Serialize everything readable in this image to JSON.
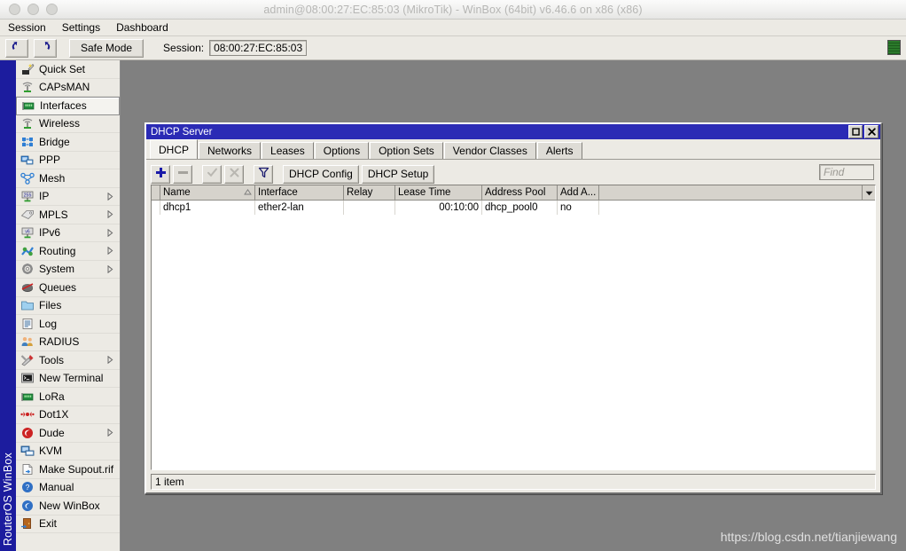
{
  "window": {
    "title": "admin@08:00:27:EC:85:03 (MikroTik) - WinBox (64bit) v6.46.6 on x86 (x86)"
  },
  "menubar": {
    "items": [
      {
        "label": "Session"
      },
      {
        "label": "Settings"
      },
      {
        "label": "Dashboard"
      }
    ]
  },
  "toolbar": {
    "undo_icon": "undo-arrow-icon",
    "redo_icon": "redo-arrow-icon",
    "safe_mode_label": "Safe Mode",
    "session_label": "Session:",
    "session_value": "08:00:27:EC:85:03",
    "status_indicator": "traffic-indicator",
    "accent_color": "#2b2bb5"
  },
  "brand": {
    "vertical_text": "RouterOS WinBox",
    "strip_color": "#1c1c9e"
  },
  "sidebar": {
    "items": [
      {
        "label": "Quick Set",
        "icon": "quick-set-icon",
        "submenu": false
      },
      {
        "label": "CAPsMAN",
        "icon": "capsman-icon",
        "submenu": false
      },
      {
        "label": "Interfaces",
        "icon": "interfaces-icon",
        "submenu": false,
        "selected": true
      },
      {
        "label": "Wireless",
        "icon": "wireless-icon",
        "submenu": false
      },
      {
        "label": "Bridge",
        "icon": "bridge-icon",
        "submenu": false
      },
      {
        "label": "PPP",
        "icon": "ppp-icon",
        "submenu": false
      },
      {
        "label": "Mesh",
        "icon": "mesh-icon",
        "submenu": false
      },
      {
        "label": "IP",
        "icon": "ip-icon",
        "submenu": true
      },
      {
        "label": "MPLS",
        "icon": "mpls-icon",
        "submenu": true
      },
      {
        "label": "IPv6",
        "icon": "ipv6-icon",
        "submenu": true
      },
      {
        "label": "Routing",
        "icon": "routing-icon",
        "submenu": true
      },
      {
        "label": "System",
        "icon": "system-gear-icon",
        "submenu": true
      },
      {
        "label": "Queues",
        "icon": "queues-icon",
        "submenu": false
      },
      {
        "label": "Files",
        "icon": "files-folder-icon",
        "submenu": false
      },
      {
        "label": "Log",
        "icon": "log-icon",
        "submenu": false
      },
      {
        "label": "RADIUS",
        "icon": "radius-users-icon",
        "submenu": false
      },
      {
        "label": "Tools",
        "icon": "tools-icon",
        "submenu": true
      },
      {
        "label": "New Terminal",
        "icon": "terminal-icon",
        "submenu": false
      },
      {
        "label": "LoRa",
        "icon": "lora-icon",
        "submenu": false
      },
      {
        "label": "Dot1X",
        "icon": "dot1x-icon",
        "submenu": false
      },
      {
        "label": "Dude",
        "icon": "dude-icon",
        "submenu": true
      },
      {
        "label": "KVM",
        "icon": "kvm-icon",
        "submenu": false
      },
      {
        "label": "Make Supout.rif",
        "icon": "supout-file-icon",
        "submenu": false
      },
      {
        "label": "Manual",
        "icon": "manual-help-icon",
        "submenu": false
      },
      {
        "label": "New WinBox",
        "icon": "new-winbox-icon",
        "submenu": false
      },
      {
        "label": "Exit",
        "icon": "exit-door-icon",
        "submenu": false
      }
    ]
  },
  "dhcp_window": {
    "title": "DHCP Server",
    "restore_button": "restore-icon",
    "close_button": "close-icon",
    "tabs": [
      {
        "label": "DHCP",
        "active": true
      },
      {
        "label": "Networks",
        "active": false
      },
      {
        "label": "Leases",
        "active": false
      },
      {
        "label": "Options",
        "active": false
      },
      {
        "label": "Option Sets",
        "active": false
      },
      {
        "label": "Vendor Classes",
        "active": false
      },
      {
        "label": "Alerts",
        "active": false
      }
    ],
    "toolbar": {
      "add_label": "+",
      "remove_label": "–",
      "enable_label": "✓",
      "disable_label": "✗",
      "filter_label": "filter",
      "dhcp_config_label": "DHCP Config",
      "dhcp_setup_label": "DHCP Setup",
      "find_placeholder": "Find"
    },
    "table": {
      "columns": [
        {
          "label": "Name",
          "width": 107,
          "sorted": true
        },
        {
          "label": "Interface",
          "width": 100,
          "sorted": false
        },
        {
          "label": "Relay",
          "width": 58,
          "sorted": false
        },
        {
          "label": "Lease Time",
          "width": 98,
          "sorted": false
        },
        {
          "label": "Address Pool",
          "width": 85,
          "sorted": false
        },
        {
          "label": "Add A...",
          "width": 47,
          "sorted": false
        }
      ],
      "rows": [
        {
          "name": "dhcp1",
          "interface": "ether2-lan",
          "relay": "",
          "lease_time": "00:10:00",
          "address_pool": "dhcp_pool0",
          "add_arp": "no"
        }
      ]
    },
    "status": "1 item"
  },
  "watermark": {
    "text": "https://blog.csdn.net/tianjiewang"
  }
}
